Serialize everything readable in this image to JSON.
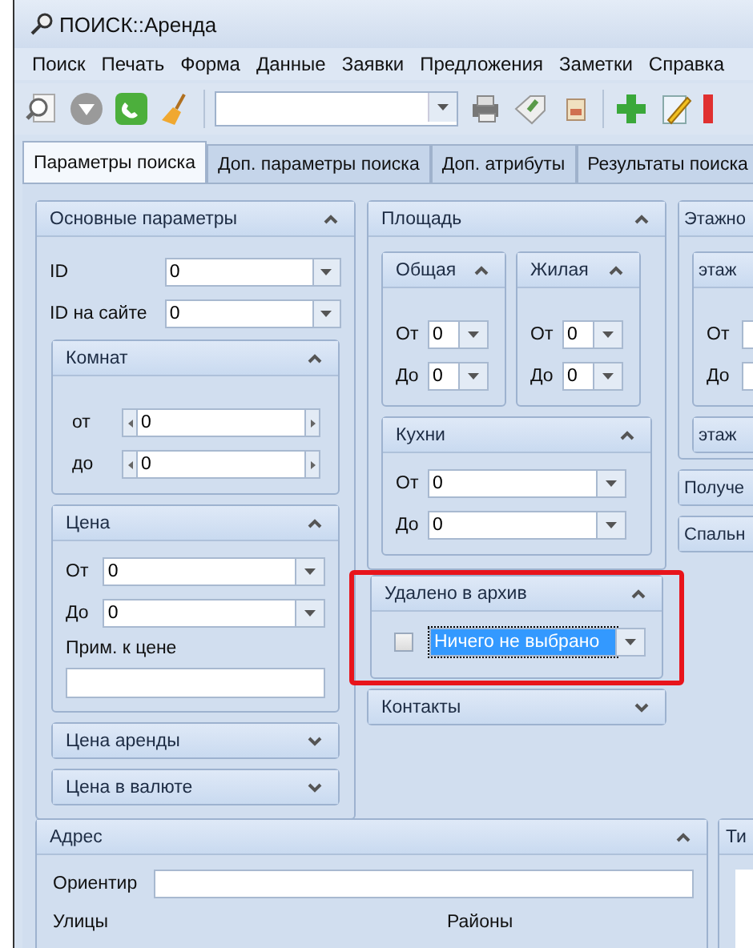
{
  "window": {
    "title": "ПОИСК::Аренда"
  },
  "menu": [
    "Поиск",
    "Печать",
    "Форма",
    "Данные",
    "Заявки",
    "Предложения",
    "Заметки",
    "Справка"
  ],
  "tabs": [
    {
      "label": "Параметры поиска",
      "selected": true
    },
    {
      "label": "Доп. параметры поиска",
      "selected": false
    },
    {
      "label": "Доп. атрибуты",
      "selected": false
    },
    {
      "label": "Результаты поиска",
      "selected": false
    }
  ],
  "main_params": {
    "title": "Основные параметры",
    "expanded": true,
    "fields": [
      {
        "label": "ID",
        "value": "0"
      },
      {
        "label": "ID на сайте",
        "value": "0"
      }
    ],
    "rooms": {
      "title": "Комнат",
      "expanded": true,
      "fields": [
        {
          "label": "от",
          "value": "0"
        },
        {
          "label": "до",
          "value": "0"
        }
      ]
    },
    "price": {
      "title": "Цена",
      "expanded": true,
      "fields": [
        {
          "label": "От",
          "value": "0"
        },
        {
          "label": "До",
          "value": "0"
        }
      ],
      "note_label": "Прим. к цене"
    },
    "collapsed": [
      {
        "title": "Цена аренды",
        "expanded": false
      },
      {
        "title": "Цена в валюте",
        "expanded": false
      }
    ]
  },
  "area": {
    "title": "Площадь",
    "expanded": true,
    "subgroups": [
      {
        "title": "Общая",
        "expanded": true,
        "fields": [
          {
            "label": "От",
            "value": "0"
          },
          {
            "label": "До",
            "value": "0"
          }
        ]
      },
      {
        "title": "Жилая",
        "expanded": true,
        "fields": [
          {
            "label": "От",
            "value": "0"
          },
          {
            "label": "До",
            "value": "0"
          }
        ]
      }
    ],
    "kitchen": {
      "title": "Кухни",
      "expanded": true,
      "fields": [
        {
          "label": "От",
          "value": "0"
        },
        {
          "label": "До",
          "value": "0"
        }
      ]
    }
  },
  "archived": {
    "title": "Удалено в архив",
    "expanded": true,
    "highlighted": true,
    "checked": false,
    "value": "Ничего не выбрано",
    "focused": true
  },
  "contacts": {
    "title": "Контакты",
    "expanded": false
  },
  "floors": {
    "title": "Этажно",
    "sub_title": "этаж",
    "fields": [
      {
        "label": "От"
      },
      {
        "label": "До"
      }
    ],
    "collapsed_title": "этаж"
  },
  "side_collapsed": [
    {
      "title": "Получе"
    },
    {
      "title": "Спальн"
    }
  ],
  "address": {
    "title": "Адрес",
    "expanded": true,
    "landmark_label": "Ориентир",
    "streets_label": "Улицы",
    "districts_label": "Районы"
  },
  "type_panel": {
    "title": "Ти"
  }
}
